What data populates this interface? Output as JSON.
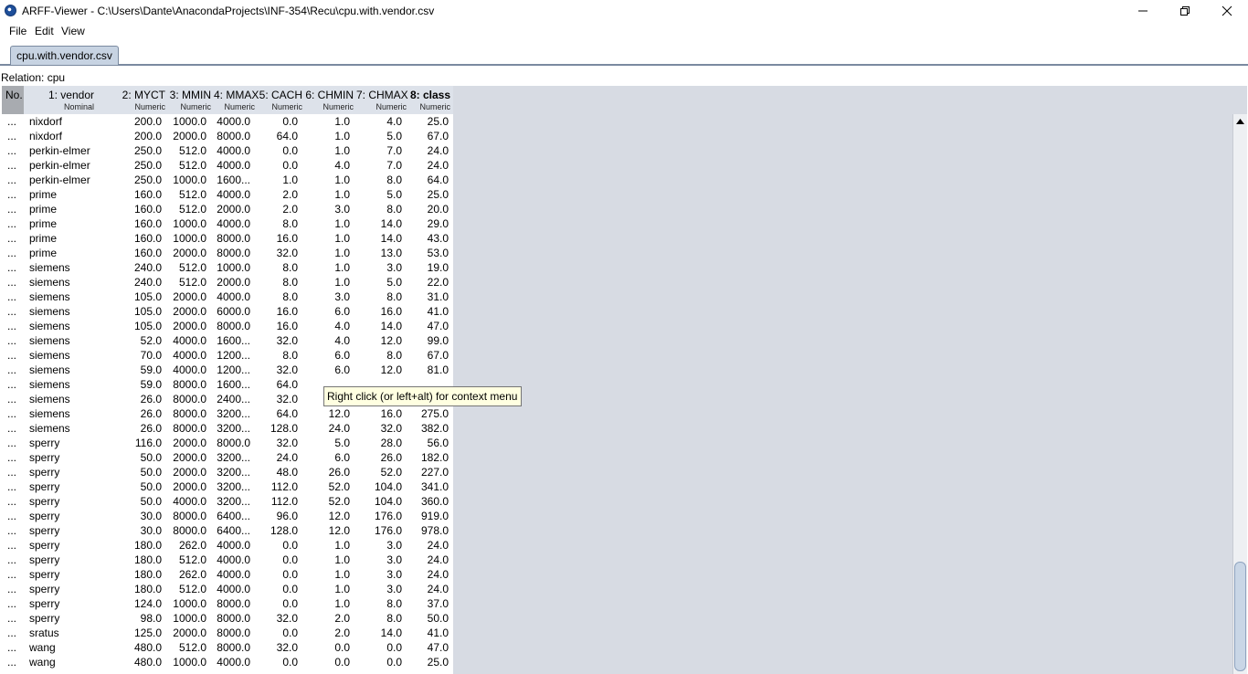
{
  "window": {
    "title": "ARFF-Viewer - C:\\Users\\Dante\\AnacondaProjects\\INF-354\\Recu\\cpu.with.vendor.csv",
    "app_icon": "weka-bird-icon"
  },
  "menu": {
    "items": [
      "File",
      "Edit",
      "View"
    ]
  },
  "tab": {
    "label": "cpu.with.vendor.csv"
  },
  "relation": {
    "label": "Relation: cpu"
  },
  "table": {
    "no_header": "No.",
    "columns": [
      {
        "name": "1: vendor",
        "type": "Nominal"
      },
      {
        "name": "2: MYCT",
        "type": "Numeric"
      },
      {
        "name": "3: MMIN",
        "type": "Numeric"
      },
      {
        "name": "4: MMAX",
        "type": "Numeric"
      },
      {
        "name": "5: CACH",
        "type": "Numeric"
      },
      {
        "name": "6: CHMIN",
        "type": "Numeric"
      },
      {
        "name": "7: CHMAX",
        "type": "Numeric"
      },
      {
        "name": "8: class",
        "type": "Numeric"
      }
    ],
    "rows": [
      [
        "...",
        "nixdorf",
        "200.0",
        "1000.0",
        "4000.0",
        "0.0",
        "1.0",
        "4.0",
        "25.0"
      ],
      [
        "...",
        "nixdorf",
        "200.0",
        "2000.0",
        "8000.0",
        "64.0",
        "1.0",
        "5.0",
        "67.0"
      ],
      [
        "...",
        "perkin-elmer",
        "250.0",
        "512.0",
        "4000.0",
        "0.0",
        "1.0",
        "7.0",
        "24.0"
      ],
      [
        "...",
        "perkin-elmer",
        "250.0",
        "512.0",
        "4000.0",
        "0.0",
        "4.0",
        "7.0",
        "24.0"
      ],
      [
        "...",
        "perkin-elmer",
        "250.0",
        "1000.0",
        "1600...",
        "1.0",
        "1.0",
        "8.0",
        "64.0"
      ],
      [
        "...",
        "prime",
        "160.0",
        "512.0",
        "4000.0",
        "2.0",
        "1.0",
        "5.0",
        "25.0"
      ],
      [
        "...",
        "prime",
        "160.0",
        "512.0",
        "2000.0",
        "2.0",
        "3.0",
        "8.0",
        "20.0"
      ],
      [
        "...",
        "prime",
        "160.0",
        "1000.0",
        "4000.0",
        "8.0",
        "1.0",
        "14.0",
        "29.0"
      ],
      [
        "...",
        "prime",
        "160.0",
        "1000.0",
        "8000.0",
        "16.0",
        "1.0",
        "14.0",
        "43.0"
      ],
      [
        "...",
        "prime",
        "160.0",
        "2000.0",
        "8000.0",
        "32.0",
        "1.0",
        "13.0",
        "53.0"
      ],
      [
        "...",
        "siemens",
        "240.0",
        "512.0",
        "1000.0",
        "8.0",
        "1.0",
        "3.0",
        "19.0"
      ],
      [
        "...",
        "siemens",
        "240.0",
        "512.0",
        "2000.0",
        "8.0",
        "1.0",
        "5.0",
        "22.0"
      ],
      [
        "...",
        "siemens",
        "105.0",
        "2000.0",
        "4000.0",
        "8.0",
        "3.0",
        "8.0",
        "31.0"
      ],
      [
        "...",
        "siemens",
        "105.0",
        "2000.0",
        "6000.0",
        "16.0",
        "6.0",
        "16.0",
        "41.0"
      ],
      [
        "...",
        "siemens",
        "105.0",
        "2000.0",
        "8000.0",
        "16.0",
        "4.0",
        "14.0",
        "47.0"
      ],
      [
        "...",
        "siemens",
        "52.0",
        "4000.0",
        "1600...",
        "32.0",
        "4.0",
        "12.0",
        "99.0"
      ],
      [
        "...",
        "siemens",
        "70.0",
        "4000.0",
        "1200...",
        "8.0",
        "6.0",
        "8.0",
        "67.0"
      ],
      [
        "...",
        "siemens",
        "59.0",
        "4000.0",
        "1200...",
        "32.0",
        "6.0",
        "12.0",
        "81.0"
      ],
      [
        "...",
        "siemens",
        "59.0",
        "8000.0",
        "1600...",
        "64.0",
        "",
        "",
        ""
      ],
      [
        "...",
        "siemens",
        "26.0",
        "8000.0",
        "2400...",
        "32.0",
        "",
        "",
        ""
      ],
      [
        "...",
        "siemens",
        "26.0",
        "8000.0",
        "3200...",
        "64.0",
        "12.0",
        "16.0",
        "275.0"
      ],
      [
        "...",
        "siemens",
        "26.0",
        "8000.0",
        "3200...",
        "128.0",
        "24.0",
        "32.0",
        "382.0"
      ],
      [
        "...",
        "sperry",
        "116.0",
        "2000.0",
        "8000.0",
        "32.0",
        "5.0",
        "28.0",
        "56.0"
      ],
      [
        "...",
        "sperry",
        "50.0",
        "2000.0",
        "3200...",
        "24.0",
        "6.0",
        "26.0",
        "182.0"
      ],
      [
        "...",
        "sperry",
        "50.0",
        "2000.0",
        "3200...",
        "48.0",
        "26.0",
        "52.0",
        "227.0"
      ],
      [
        "...",
        "sperry",
        "50.0",
        "2000.0",
        "3200...",
        "112.0",
        "52.0",
        "104.0",
        "341.0"
      ],
      [
        "...",
        "sperry",
        "50.0",
        "4000.0",
        "3200...",
        "112.0",
        "52.0",
        "104.0",
        "360.0"
      ],
      [
        "...",
        "sperry",
        "30.0",
        "8000.0",
        "6400...",
        "96.0",
        "12.0",
        "176.0",
        "919.0"
      ],
      [
        "...",
        "sperry",
        "30.0",
        "8000.0",
        "6400...",
        "128.0",
        "12.0",
        "176.0",
        "978.0"
      ],
      [
        "...",
        "sperry",
        "180.0",
        "262.0",
        "4000.0",
        "0.0",
        "1.0",
        "3.0",
        "24.0"
      ],
      [
        "...",
        "sperry",
        "180.0",
        "512.0",
        "4000.0",
        "0.0",
        "1.0",
        "3.0",
        "24.0"
      ],
      [
        "...",
        "sperry",
        "180.0",
        "262.0",
        "4000.0",
        "0.0",
        "1.0",
        "3.0",
        "24.0"
      ],
      [
        "...",
        "sperry",
        "180.0",
        "512.0",
        "4000.0",
        "0.0",
        "1.0",
        "3.0",
        "24.0"
      ],
      [
        "...",
        "sperry",
        "124.0",
        "1000.0",
        "8000.0",
        "0.0",
        "1.0",
        "8.0",
        "37.0"
      ],
      [
        "...",
        "sperry",
        "98.0",
        "1000.0",
        "8000.0",
        "32.0",
        "2.0",
        "8.0",
        "50.0"
      ],
      [
        "...",
        "sratus",
        "125.0",
        "2000.0",
        "8000.0",
        "0.0",
        "2.0",
        "14.0",
        "41.0"
      ],
      [
        "...",
        "wang",
        "480.0",
        "512.0",
        "8000.0",
        "32.0",
        "0.0",
        "0.0",
        "47.0"
      ],
      [
        "...",
        "wang",
        "480.0",
        "1000.0",
        "4000.0",
        "0.0",
        "0.0",
        "0.0",
        "25.0"
      ]
    ]
  },
  "tooltip": {
    "text": "Right click (or left+alt) for context menu"
  }
}
